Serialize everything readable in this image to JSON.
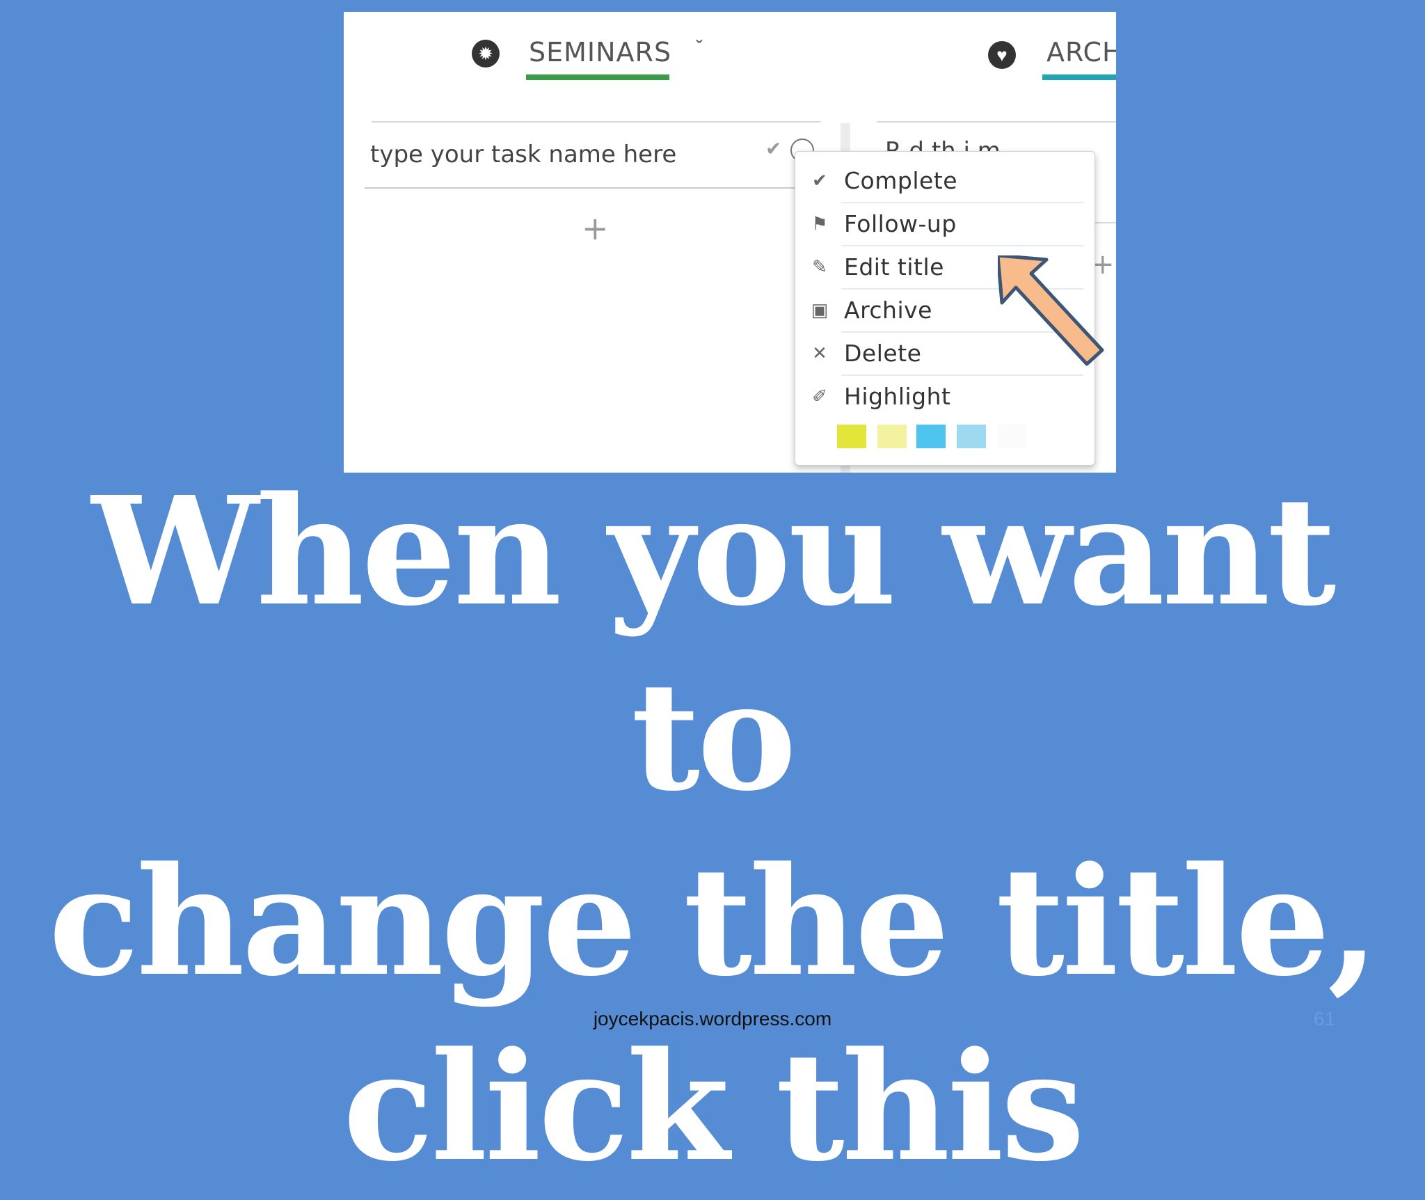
{
  "screenshot": {
    "tabs": [
      {
        "label": "SEMINARS",
        "icon": "lightbulb-icon",
        "underline_color": "#3a9c46"
      },
      {
        "label": "ARCH",
        "icon": "heart-icon",
        "underline_color": "#1fa5b5"
      }
    ],
    "task_input": {
      "placeholder": "type your task name here"
    },
    "add_symbol": "+",
    "second_column_text": "R   d   th   i   m",
    "menu": {
      "items": [
        {
          "label": "Complete",
          "icon": "check-icon"
        },
        {
          "label": "Follow-up",
          "icon": "flag-icon"
        },
        {
          "label": "Edit title",
          "icon": "pencil-icon"
        },
        {
          "label": "Archive",
          "icon": "archive-box-icon"
        },
        {
          "label": "Delete",
          "icon": "x-icon"
        },
        {
          "label": "Highlight",
          "icon": "highlighter-icon"
        }
      ],
      "highlight_colors": [
        "#e2e53a",
        "#f3f29e",
        "#4fc4ef",
        "#9dd9f0",
        "#ffffff"
      ]
    },
    "arrow_color": "#f7bb8c"
  },
  "headline": {
    "lines": [
      "When you want to",
      "change the title,",
      "click this"
    ]
  },
  "footer": {
    "website": "joycekpacis.wordpress.com",
    "page_number": "61"
  }
}
